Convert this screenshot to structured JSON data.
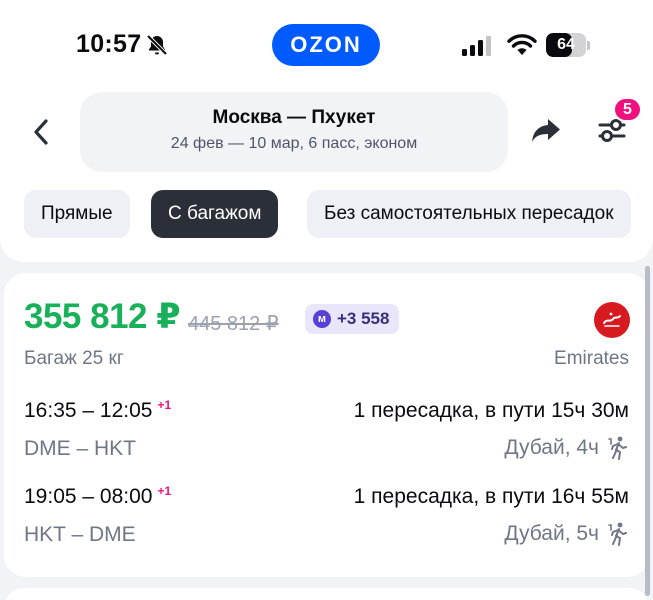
{
  "status_bar": {
    "time": "10:57",
    "brand": "OZON",
    "battery": "64",
    "battery_level": 0.64
  },
  "header": {
    "route": "Москва — Пхукет",
    "details": "24 фев — 10 мар, 6 пасс, эконом",
    "filter_count": "5"
  },
  "chips": [
    "Прямые",
    "С багажом",
    "Без самостоятельных пересадок"
  ],
  "active_chip": "С багажом",
  "offer": {
    "price": "355 812 ₽",
    "old_price": "445 812 ₽",
    "points": "+3 558",
    "points_icon_letter": "м",
    "baggage": "Багаж 25 кг",
    "airline": "Emirates",
    "segments": [
      {
        "times": "16:35 – 12:05",
        "next_day": "+1",
        "airports": "DME – HKT",
        "summary": "1 пересадка, в пути 15ч 30м",
        "stop": "Дубай, 4ч"
      },
      {
        "times": "19:05 – 08:00",
        "next_day": "+1",
        "airports": "HKT – DME",
        "summary": "1 пересадка, в пути 16ч 55м",
        "stop": "Дубай, 5ч"
      }
    ]
  },
  "colors": {
    "accent": "#005bff",
    "price_green": "#18b058",
    "badge_pink": "#f1117e",
    "active_chip": "#2b2f38"
  },
  "icons": {
    "back": "chevron-left-icon",
    "share": "share-arrow-icon",
    "filter": "sliders-icon",
    "mute": "bell-off-icon",
    "stop": "walking-person-icon"
  }
}
